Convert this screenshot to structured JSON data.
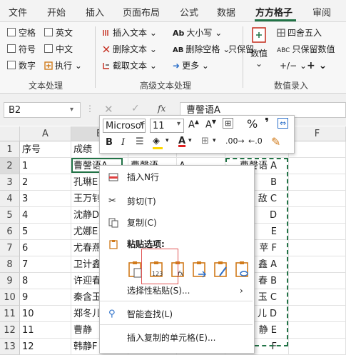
{
  "ribbon_tabs": [
    "文件",
    "开始",
    "插入",
    "页面布局",
    "公式",
    "数据",
    "方方格子",
    "审阅"
  ],
  "active_tab": "方方格子",
  "text_group": {
    "checkboxes": [
      "空格",
      "英文",
      "符号",
      "中文",
      "数字"
    ],
    "exec_label": "执行",
    "label": "文本处理"
  },
  "adv_group": {
    "insert_text": "插入文本",
    "delete_text": "删除文本",
    "extract_text": "截取文本",
    "case": "大小写",
    "delete_space": "删除空格",
    "only_keep": "只保留",
    "more": "更多",
    "label": "高级文本处理"
  },
  "num_group": {
    "value_btn": "数值",
    "round": "四舍五入",
    "keep_value": "只保留数值",
    "label": "数值录入"
  },
  "formula_bar": {
    "name_box": "B2",
    "fx": "fx",
    "content": "曹謦语A"
  },
  "columns": [
    "A",
    "B",
    "F"
  ],
  "rows": [
    {
      "n": "1",
      "a": "序号",
      "b": "成绩",
      "e": ""
    },
    {
      "n": "2",
      "a": "1",
      "b": "曹謦语A",
      "c": "曹謦语",
      "d": "A",
      "e": "曹謦语 A"
    },
    {
      "n": "3",
      "a": "2",
      "b": "孔琳E",
      "e": "B"
    },
    {
      "n": "4",
      "a": "3",
      "b": "王万钊",
      "e": "敌 C"
    },
    {
      "n": "5",
      "a": "4",
      "b": "沈静D",
      "e": "D"
    },
    {
      "n": "6",
      "a": "5",
      "b": "尤娜E",
      "e": "E"
    },
    {
      "n": "7",
      "a": "6",
      "b": "尤春燕",
      "e": "苹 F"
    },
    {
      "n": "8",
      "a": "7",
      "b": "卫计鑫",
      "e": "鑫 A"
    },
    {
      "n": "9",
      "a": "8",
      "b": "许迎春",
      "e": "春 B"
    },
    {
      "n": "10",
      "a": "9",
      "b": "秦含玉",
      "e": "玉 C"
    },
    {
      "n": "11",
      "a": "10",
      "b": "郑冬儿",
      "e": "儿 D"
    },
    {
      "n": "12",
      "a": "11",
      "b": "曹静",
      "e": "静 E"
    },
    {
      "n": "13",
      "a": "12",
      "b": "韩静F",
      "e": "F"
    }
  ],
  "mini_toolbar": {
    "font": "Microsoft",
    "size": "11",
    "bold": "B",
    "italic": "I",
    "percent": "%"
  },
  "context_menu": {
    "insert_n_rows": "插入N行",
    "cut": "剪切(T)",
    "copy": "复制(C)",
    "paste_options": "粘贴选项:",
    "paste_special": "选择性粘贴(S)...",
    "smart_lookup": "智能查找(L)",
    "insert_copied": "插入复制的单元格(E)..."
  },
  "colors": {
    "accent": "#217346",
    "marquee": "#217346",
    "highlight_box": "#e05555"
  }
}
